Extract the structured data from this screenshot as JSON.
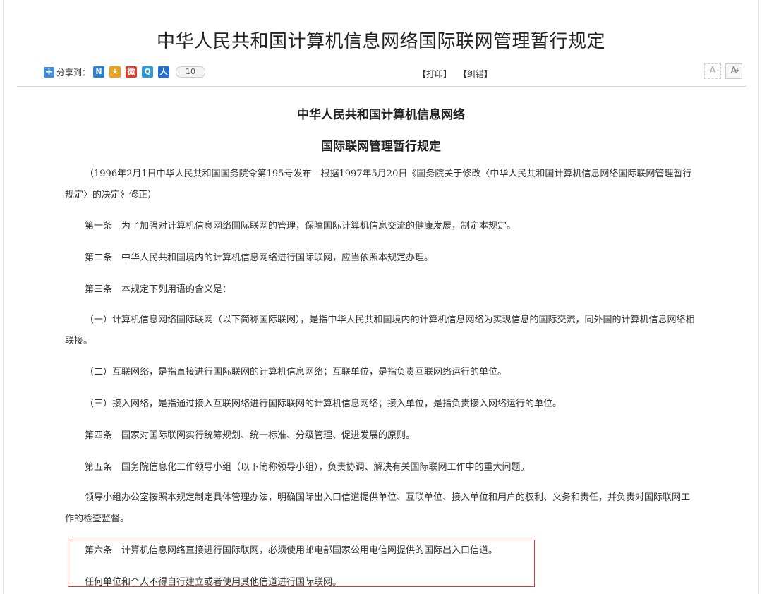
{
  "page": {
    "title": "中华人民共和国计算机信息网络国际联网管理暂行规定"
  },
  "toolbar": {
    "share_label": "分享到：",
    "share_count": "10",
    "print_label": "【打印】",
    "correct_label": "【纠错】",
    "font_decrease": "A",
    "font_increase": "A",
    "font_decrease_sup": "-",
    "font_increase_sup": "+"
  },
  "share_icons": [
    {
      "name": "share-icon-1",
      "glyph": "N",
      "color": "#2a7fd4"
    },
    {
      "name": "share-icon-2",
      "glyph": "★",
      "color": "#e8a21c"
    },
    {
      "name": "share-icon-3",
      "glyph": "微",
      "color": "#d9412e"
    },
    {
      "name": "share-icon-4",
      "glyph": "Q",
      "color": "#2d9ad8"
    },
    {
      "name": "share-icon-5",
      "glyph": "人",
      "color": "#1f6fcf"
    }
  ],
  "document": {
    "title_line1": "中华人民共和国计算机信息网络",
    "title_line2": "国际联网管理暂行规定",
    "paragraphs": [
      "（1996年2月1日中华人民共和国国务院令第195号发布　根据1997年5月20日《国务院关于修改〈中华人民共和国计算机信息网络国际联网管理暂行规定〉的决定》修正）",
      "第一条　为了加强对计算机信息网络国际联网的管理，保障国际计算机信息交流的健康发展，制定本规定。",
      "第二条　中华人民共和国境内的计算机信息网络进行国际联网，应当依照本规定办理。",
      "第三条　本规定下列用语的含义是：",
      "（一）计算机信息网络国际联网（以下简称国际联网），是指中华人民共和国境内的计算机信息网络为实现信息的国际交流，同外国的计算机信息网络相联接。",
      "（二）互联网络，是指直接进行国际联网的计算机信息网络；互联单位，是指负责互联网络运行的单位。",
      "（三）接入网络，是指通过接入互联网络进行国际联网的计算机信息网络；接入单位，是指负责接入网络运行的单位。",
      "第四条　国家对国际联网实行统筹规划、统一标准、分级管理、促进发展的原则。",
      "第五条　国务院信息化工作领导小组（以下简称领导小组），负责协调、解决有关国际联网工作中的重大问题。",
      "领导小组办公室按照本规定制定具体管理办法，明确国际出入口信道提供单位、互联单位、接入单位和用户的权利、义务和责任，并负责对国际联网工作的检查监督。",
      "第六条　计算机信息网络直接进行国际联网，必须使用邮电部国家公用电信网提供的国际出入口信道。",
      "任何单位和个人不得自行建立或者使用其他信道进行国际联网。"
    ]
  }
}
